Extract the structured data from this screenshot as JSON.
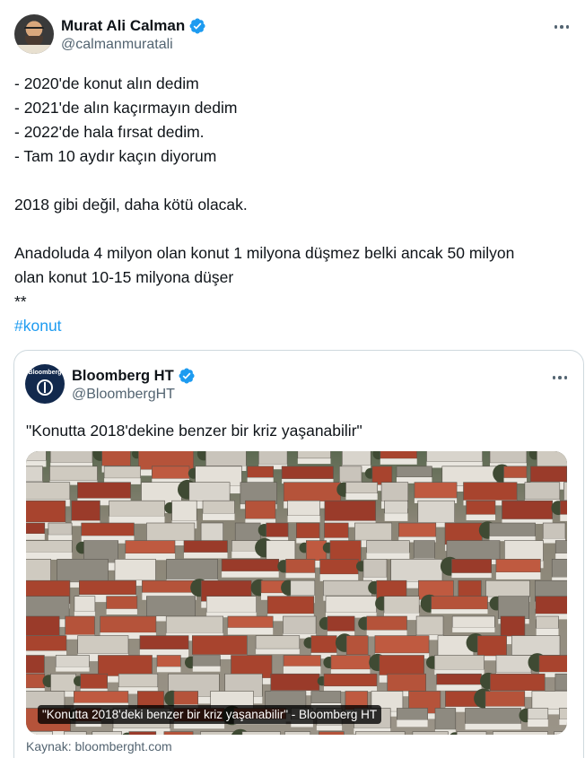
{
  "author": {
    "display_name": "Murat Ali Calman",
    "handle": "@calmanmuratali",
    "verified_icon": "verified-badge-icon",
    "verified_color": "#1d9bf0"
  },
  "tweet": {
    "lines": [
      "- 2020'de konut alın dedim",
      "- 2021'de alın kaçırmayın dedim",
      "- 2022'de hala fırsat dedim.",
      "- Tam 10 aydır kaçın diyorum"
    ],
    "paragraph2": "2018 gibi değil, daha kötü olacak.",
    "paragraph3_line1": "Anadoluda 4 milyon olan konut 1 milyona düşmez belki ancak 50 milyon",
    "paragraph3_line2": "olan konut 10-15 milyona düşer",
    "stars": "**",
    "hashtag": "#konut"
  },
  "quoted": {
    "display_name": "Bloomberg HT",
    "handle": "@BloombergHT",
    "avatar_text": "Bloomberg",
    "quote_text": "\"Konutta 2018'dekine benzer bir kriz yaşanabilir\"",
    "media_caption": "\"Konutta 2018'deki benzer bir kriz yaşanabilir\" - Bloomberg HT",
    "source": "Kaynak: bloomberght.com"
  },
  "colors": {
    "text": "#0f1419",
    "secondary": "#536471",
    "link": "#1d9bf0",
    "border": "#cfd9de"
  }
}
